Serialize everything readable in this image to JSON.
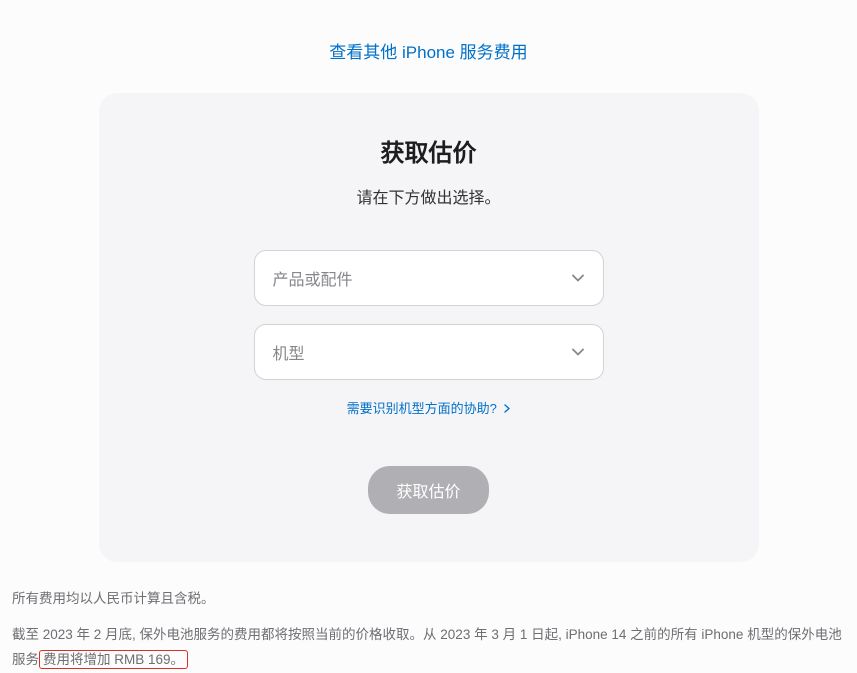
{
  "topLink": {
    "label": "查看其他 iPhone 服务费用"
  },
  "card": {
    "title": "获取估价",
    "subtitle": "请在下方做出选择。",
    "select1": {
      "placeholder": "产品或配件"
    },
    "select2": {
      "placeholder": "机型"
    },
    "helpLink": {
      "label": "需要识别机型方面的协助?"
    },
    "submit": {
      "label": "获取估价"
    }
  },
  "footnotes": {
    "line1": "所有费用均以人民币计算且含税。",
    "line2_part1": "截至 2023 年 2 月底, 保外电池服务的费用都将按照当前的价格收取。从 2023 年 3 月 1 日起, iPhone 14 之前的所有 iPhone 机型的保外电池服务",
    "line2_highlight": "费用将增加 RMB 169。"
  }
}
